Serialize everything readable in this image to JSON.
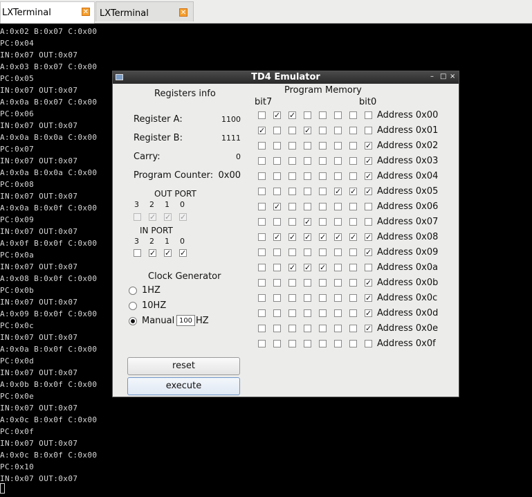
{
  "tabs": [
    {
      "label": "LXTerminal",
      "close": "✕"
    },
    {
      "label": "LXTerminal",
      "close": "✕"
    }
  ],
  "terminal": {
    "lines": [
      "A:0x02 B:0x07 C:0x00",
      "PC:0x04",
      "IN:0x07 OUT:0x07",
      "A:0x03 B:0x07 C:0x00",
      "PC:0x05",
      "IN:0x07 OUT:0x07",
      "A:0x0a B:0x07 C:0x00",
      "PC:0x06",
      "IN:0x07 OUT:0x07",
      "A:0x0a B:0x0a C:0x00",
      "PC:0x07",
      "IN:0x07 OUT:0x07",
      "A:0x0a B:0x0a C:0x00",
      "PC:0x08",
      "IN:0x07 OUT:0x07",
      "A:0x0a B:0x0f C:0x00",
      "PC:0x09",
      "IN:0x07 OUT:0x07",
      "A:0x0f B:0x0f C:0x00",
      "PC:0x0a",
      "IN:0x07 OUT:0x07",
      "A:0x08 B:0x0f C:0x00",
      "PC:0x0b",
      "IN:0x07 OUT:0x07",
      "A:0x09 B:0x0f C:0x00",
      "PC:0x0c",
      "IN:0x07 OUT:0x07",
      "A:0x0a B:0x0f C:0x00",
      "PC:0x0d",
      "IN:0x07 OUT:0x07",
      "A:0x0b B:0x0f C:0x00",
      "PC:0x0e",
      "IN:0x07 OUT:0x07",
      "A:0x0c B:0x0f C:0x00",
      "PC:0x0f",
      "IN:0x07 OUT:0x07",
      "A:0x0c B:0x0f C:0x00",
      "PC:0x10",
      "IN:0x07 OUT:0x07"
    ]
  },
  "window": {
    "title": "TD4 Emulator",
    "buttons": {
      "minimize": "–",
      "maximize": "□",
      "close": "×"
    }
  },
  "registers": {
    "title": "Registers info",
    "a_label": "Register A:",
    "a_value": "1100",
    "b_label": "Register B:",
    "b_value": "1111",
    "carry_label": "Carry:",
    "carry_value": "0",
    "pc_label": "Program Counter:",
    "pc_value": "0x00"
  },
  "out_port": {
    "title": "OUT PORT",
    "bit_labels": [
      "3",
      "2",
      "1",
      "0"
    ],
    "bits": [
      false,
      true,
      true,
      true
    ]
  },
  "in_port": {
    "title": "IN PORT",
    "bit_labels": [
      "3",
      "2",
      "1",
      "0"
    ],
    "bits": [
      false,
      true,
      true,
      true
    ]
  },
  "clock": {
    "title": "Clock Generator",
    "options": [
      "1HZ",
      "10HZ",
      "Manual"
    ],
    "selected": "Manual",
    "manual_value": "100",
    "manual_unit": "HZ"
  },
  "buttons": {
    "reset": "reset",
    "execute": "execute"
  },
  "program_memory": {
    "title": "Program Memory",
    "bit7_label": "bit7",
    "bit0_label": "bit0",
    "rows": [
      {
        "address": "Address 0x00",
        "bits": [
          0,
          1,
          1,
          0,
          0,
          0,
          0,
          0
        ]
      },
      {
        "address": "Address 0x01",
        "bits": [
          1,
          0,
          0,
          1,
          0,
          0,
          0,
          0
        ]
      },
      {
        "address": "Address 0x02",
        "bits": [
          0,
          0,
          0,
          0,
          0,
          0,
          0,
          1
        ]
      },
      {
        "address": "Address 0x03",
        "bits": [
          0,
          0,
          0,
          0,
          0,
          0,
          0,
          1
        ]
      },
      {
        "address": "Address 0x04",
        "bits": [
          0,
          0,
          0,
          0,
          0,
          0,
          0,
          1
        ]
      },
      {
        "address": "Address 0x05",
        "bits": [
          0,
          0,
          0,
          0,
          0,
          1,
          1,
          1
        ]
      },
      {
        "address": "Address 0x06",
        "bits": [
          0,
          1,
          0,
          0,
          0,
          0,
          0,
          0
        ]
      },
      {
        "address": "Address 0x07",
        "bits": [
          0,
          0,
          0,
          1,
          0,
          0,
          0,
          0
        ]
      },
      {
        "address": "Address 0x08",
        "bits": [
          0,
          1,
          1,
          1,
          1,
          1,
          1,
          1
        ]
      },
      {
        "address": "Address 0x09",
        "bits": [
          0,
          0,
          0,
          0,
          0,
          0,
          0,
          1
        ]
      },
      {
        "address": "Address 0x0a",
        "bits": [
          0,
          0,
          1,
          1,
          1,
          0,
          0,
          0
        ]
      },
      {
        "address": "Address 0x0b",
        "bits": [
          0,
          0,
          0,
          0,
          0,
          0,
          0,
          1
        ]
      },
      {
        "address": "Address 0x0c",
        "bits": [
          0,
          0,
          0,
          0,
          0,
          0,
          0,
          1
        ]
      },
      {
        "address": "Address 0x0d",
        "bits": [
          0,
          0,
          0,
          0,
          0,
          0,
          0,
          1
        ]
      },
      {
        "address": "Address 0x0e",
        "bits": [
          0,
          0,
          0,
          0,
          0,
          0,
          0,
          1
        ]
      },
      {
        "address": "Address 0x0f",
        "bits": [
          0,
          0,
          0,
          0,
          0,
          0,
          0,
          0
        ]
      }
    ]
  }
}
